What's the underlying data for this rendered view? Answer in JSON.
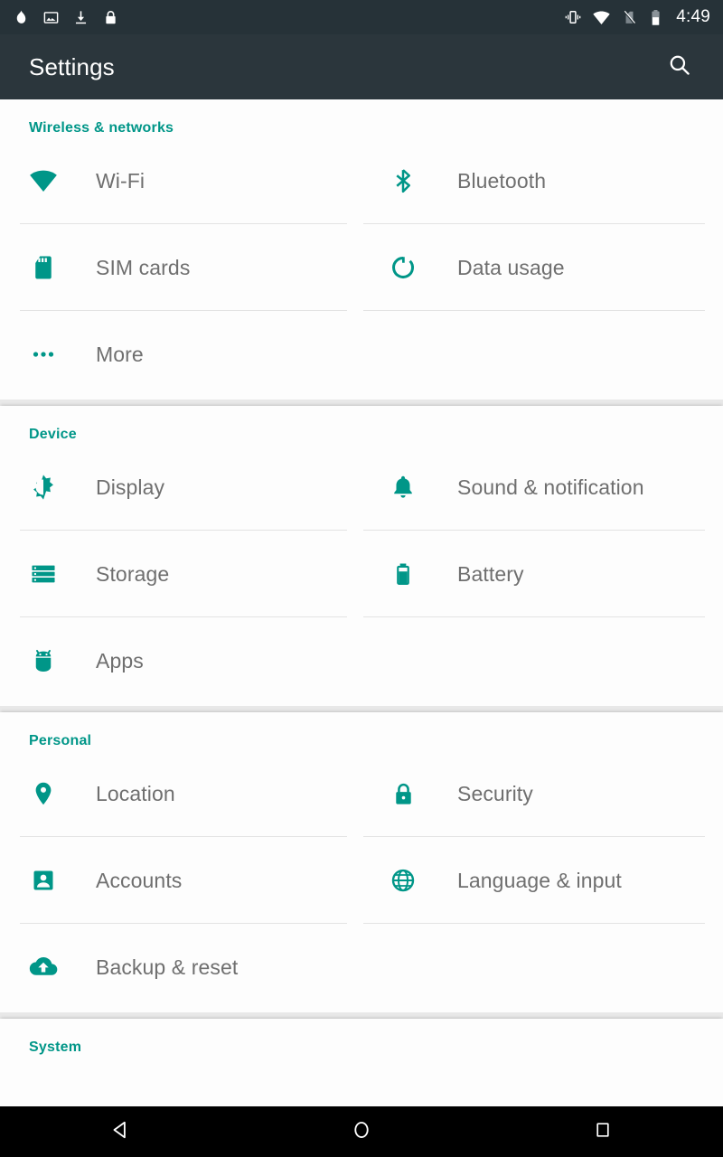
{
  "status_bar": {
    "left_icons": [
      {
        "name": "flame-icon",
        "label": "flame"
      },
      {
        "name": "image-icon",
        "label": "screenshot"
      },
      {
        "name": "download-icon",
        "label": "download"
      },
      {
        "name": "lock-icon",
        "label": "lock"
      }
    ],
    "right_icons": [
      {
        "name": "vibrate-icon",
        "label": "vibrate"
      },
      {
        "name": "wifi-icon",
        "label": "wifi"
      },
      {
        "name": "no-sim-icon",
        "label": "no-sim"
      },
      {
        "name": "battery-icon",
        "label": "battery"
      }
    ],
    "time": "4:49"
  },
  "app_bar": {
    "title": "Settings",
    "search_icon": "search-icon"
  },
  "colors": {
    "accent": "#009688",
    "status_bar_bg": "#263238",
    "app_bar_bg": "#2b363c",
    "label_text": "#6f6f6f",
    "section_bg": "#fdfdfd",
    "divider": "#e3e3e3",
    "nav_bar_bg": "#000000"
  },
  "sections": [
    {
      "header": "Wireless & networks",
      "items": [
        {
          "label": "Wi-Fi",
          "icon": "wifi-icon",
          "column": "left"
        },
        {
          "label": "Bluetooth",
          "icon": "bluetooth-icon",
          "column": "right"
        },
        {
          "label": "SIM cards",
          "icon": "sim-card-icon",
          "column": "left"
        },
        {
          "label": "Data usage",
          "icon": "data-usage-icon",
          "column": "right"
        },
        {
          "label": "More",
          "icon": "more-icon",
          "column": "left"
        }
      ]
    },
    {
      "header": "Device",
      "items": [
        {
          "label": "Display",
          "icon": "brightness-icon",
          "column": "left"
        },
        {
          "label": "Sound & notification",
          "icon": "bell-icon",
          "column": "right"
        },
        {
          "label": "Storage",
          "icon": "storage-icon",
          "column": "left"
        },
        {
          "label": "Battery",
          "icon": "battery-icon",
          "column": "right"
        },
        {
          "label": "Apps",
          "icon": "android-icon",
          "column": "left"
        }
      ]
    },
    {
      "header": "Personal",
      "items": [
        {
          "label": "Location",
          "icon": "location-pin-icon",
          "column": "left"
        },
        {
          "label": "Security",
          "icon": "lock-icon",
          "column": "right"
        },
        {
          "label": "Accounts",
          "icon": "account-icon",
          "column": "left"
        },
        {
          "label": "Language & input",
          "icon": "globe-icon",
          "column": "right"
        },
        {
          "label": "Backup & reset",
          "icon": "cloud-upload-icon",
          "column": "left"
        }
      ]
    },
    {
      "header": "System",
      "items": []
    }
  ],
  "nav_bar": {
    "back_label": "Back",
    "home_label": "Home",
    "recents_label": "Recent apps"
  }
}
